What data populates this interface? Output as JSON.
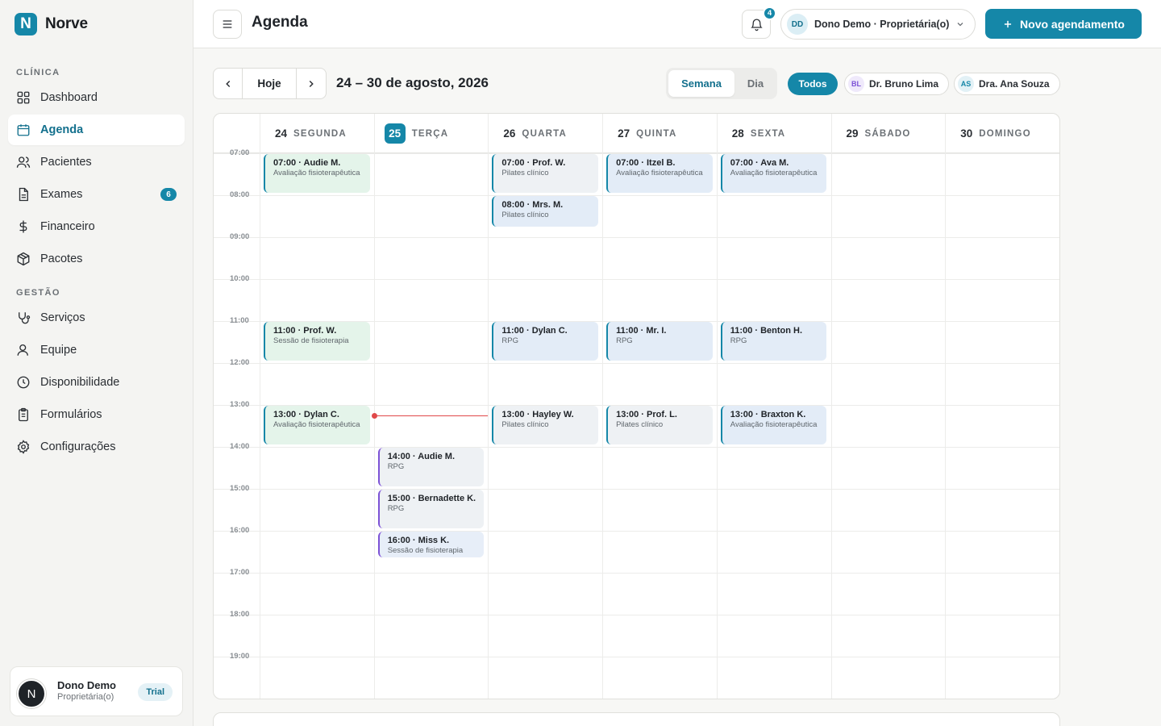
{
  "brand": {
    "logo_letter": "N",
    "name": "Norve",
    "accent": "#1587a8"
  },
  "sidebar": {
    "section_clinic": "CLÍNICA",
    "section_management": "GESTÃO",
    "items": [
      {
        "label": "Dashboard",
        "icon": "dashboard-icon"
      },
      {
        "label": "Agenda",
        "icon": "calendar-icon",
        "active": true
      },
      {
        "label": "Pacientes",
        "icon": "users-icon"
      },
      {
        "label": "Exames",
        "icon": "document-icon",
        "badge": "6"
      },
      {
        "label": "Financeiro",
        "icon": "dollar-icon"
      },
      {
        "label": "Pacotes",
        "icon": "package-icon"
      },
      {
        "label": "Serviços",
        "icon": "stethoscope-icon"
      },
      {
        "label": "Equipe",
        "icon": "user-icon"
      },
      {
        "label": "Disponibilidade",
        "icon": "clock-icon"
      },
      {
        "label": "Formulários",
        "icon": "clipboard-icon"
      },
      {
        "label": "Configurações",
        "icon": "gear-icon"
      }
    ],
    "user": {
      "avatar": "N",
      "name": "Dono Demo",
      "role": "Proprietária(o)",
      "plan": "Trial"
    }
  },
  "topbar": {
    "title": "Agenda",
    "notifications": "4",
    "account_initials": "DD",
    "account_label": "Dono Demo · Proprietária(o)",
    "new_button": "Novo agendamento"
  },
  "toolbar": {
    "today": "Hoje",
    "range": "24 – 30 de agosto, 2026",
    "view_week": "Semana",
    "view_day": "Dia",
    "filter_all": "Todos",
    "doctors": [
      {
        "initials": "BL",
        "name": "Dr. Bruno Lima",
        "color": "#7c52d6",
        "bg": "#efe9fb"
      },
      {
        "initials": "AS",
        "name": "Dra. Ana Souza",
        "color": "#1587a8",
        "bg": "#e2f1f6"
      }
    ]
  },
  "calendar": {
    "days": [
      {
        "num": "24",
        "name": "SEGUNDA"
      },
      {
        "num": "25",
        "name": "TERÇA",
        "today": true
      },
      {
        "num": "26",
        "name": "QUARTA"
      },
      {
        "num": "27",
        "name": "QUINTA"
      },
      {
        "num": "28",
        "name": "SEXTA"
      },
      {
        "num": "29",
        "name": "SÁBADO"
      },
      {
        "num": "30",
        "name": "DOMINGO"
      }
    ],
    "hours": [
      "07:00",
      "08:00",
      "09:00",
      "10:00",
      "11:00",
      "12:00",
      "13:00",
      "14:00",
      "15:00",
      "16:00",
      "17:00",
      "18:00",
      "19:00"
    ],
    "events": [
      {
        "day": 0,
        "start": 7,
        "dur": 1,
        "title": "07:00 · Audie M.",
        "sub": "Avaliação fisioterapêutica",
        "style": "green"
      },
      {
        "day": 0,
        "start": 11,
        "dur": 1,
        "title": "11:00 · Prof. W.",
        "sub": "Sessão de fisioterapia",
        "style": "green"
      },
      {
        "day": 0,
        "start": 13,
        "dur": 1,
        "title": "13:00 · Dylan C.",
        "sub": "Avaliação fisioterapêutica",
        "style": "green"
      },
      {
        "day": 1,
        "start": 14,
        "dur": 1,
        "title": "14:00 · Audie M.",
        "sub": "RPG",
        "style": "gray"
      },
      {
        "day": 1,
        "start": 15,
        "dur": 1,
        "title": "15:00 · Bernadette K.",
        "sub": "RPG",
        "style": "gray"
      },
      {
        "day": 1,
        "start": 16,
        "dur": 0.7,
        "title": "16:00 · Miss K.",
        "sub": "Sessão de fisioterapia",
        "style": "lav"
      },
      {
        "day": 2,
        "start": 7,
        "dur": 1,
        "title": "07:00 · Prof. W.",
        "sub": "Pilates clínico",
        "style": "grayb"
      },
      {
        "day": 2,
        "start": 8,
        "dur": 0.8,
        "title": "08:00 · Mrs. M.",
        "sub": "Pilates clínico",
        "style": "blue"
      },
      {
        "day": 2,
        "start": 11,
        "dur": 1,
        "title": "11:00 · Dylan C.",
        "sub": "RPG",
        "style": "blue"
      },
      {
        "day": 2,
        "start": 13,
        "dur": 1,
        "title": "13:00 · Hayley W.",
        "sub": "Pilates clínico",
        "style": "grayb"
      },
      {
        "day": 3,
        "start": 7,
        "dur": 1,
        "title": "07:00 · Itzel B.",
        "sub": "Avaliação fisioterapêutica",
        "style": "blue"
      },
      {
        "day": 3,
        "start": 11,
        "dur": 1,
        "title": "11:00 · Mr. I.",
        "sub": "RPG",
        "style": "blue"
      },
      {
        "day": 3,
        "start": 13,
        "dur": 1,
        "title": "13:00 · Prof. L.",
        "sub": "Pilates clínico",
        "style": "grayb"
      },
      {
        "day": 4,
        "start": 7,
        "dur": 1,
        "title": "07:00 · Ava M.",
        "sub": "Avaliação fisioterapêutica",
        "style": "blue"
      },
      {
        "day": 4,
        "start": 11,
        "dur": 1,
        "title": "11:00 · Benton H.",
        "sub": "RPG",
        "style": "blue"
      },
      {
        "day": 4,
        "start": 13,
        "dur": 1,
        "title": "13:00 · Braxton K.",
        "sub": "Avaliação fisioterapêutica",
        "style": "blue"
      }
    ],
    "now": {
      "day": 1,
      "hour": 13.25
    }
  }
}
